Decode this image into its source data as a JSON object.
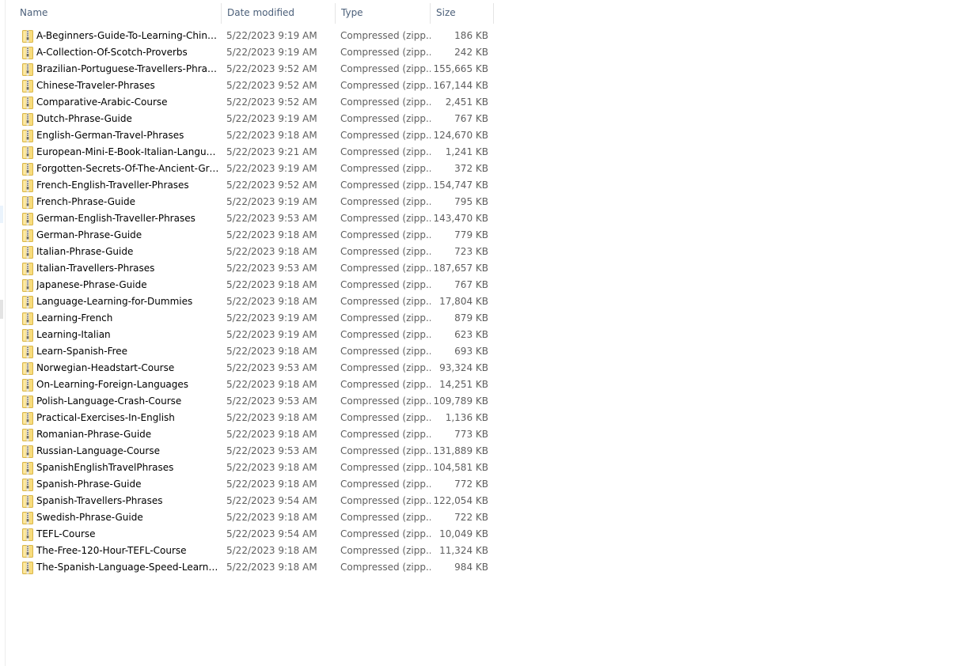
{
  "columns": {
    "name": "Name",
    "date": "Date modified",
    "type": "Type",
    "size": "Size",
    "sort_indicator": "^"
  },
  "icons": {
    "file": "zip-folder-icon",
    "sort": "sort-ascending-icon"
  },
  "colors": {
    "header_text": "#4c607a",
    "zip_folder": "#f3d36a",
    "zipper": "#8a8a8a"
  },
  "files": [
    {
      "name": "A-Beginners-Guide-To-Learning-Chinese",
      "date": "5/22/2023 9:19 AM",
      "type": "Compressed (zipp...",
      "size": "186 KB"
    },
    {
      "name": "A-Collection-Of-Scotch-Proverbs",
      "date": "5/22/2023 9:19 AM",
      "type": "Compressed (zipp...",
      "size": "242 KB"
    },
    {
      "name": "Brazilian-Portuguese-Travellers-Phrases",
      "date": "5/22/2023 9:52 AM",
      "type": "Compressed (zipp...",
      "size": "155,665 KB"
    },
    {
      "name": "Chinese-Traveler-Phrases",
      "date": "5/22/2023 9:52 AM",
      "type": "Compressed (zipp...",
      "size": "167,144 KB"
    },
    {
      "name": "Comparative-Arabic-Course",
      "date": "5/22/2023 9:52 AM",
      "type": "Compressed (zipp...",
      "size": "2,451 KB"
    },
    {
      "name": "Dutch-Phrase-Guide",
      "date": "5/22/2023 9:19 AM",
      "type": "Compressed (zipp...",
      "size": "767 KB"
    },
    {
      "name": "English-German-Travel-Phrases",
      "date": "5/22/2023 9:18 AM",
      "type": "Compressed (zipp...",
      "size": "124,670 KB"
    },
    {
      "name": "European-Mini-E-Book-Italian-Language...",
      "date": "5/22/2023 9:21 AM",
      "type": "Compressed (zipp...",
      "size": "1,241 KB"
    },
    {
      "name": "Forgotten-Secrets-Of-The-Ancient-Greek",
      "date": "5/22/2023 9:19 AM",
      "type": "Compressed (zipp...",
      "size": "372 KB"
    },
    {
      "name": "French-English-Traveller-Phrases",
      "date": "5/22/2023 9:52 AM",
      "type": "Compressed (zipp...",
      "size": "154,747 KB"
    },
    {
      "name": "French-Phrase-Guide",
      "date": "5/22/2023 9:19 AM",
      "type": "Compressed (zipp...",
      "size": "795 KB"
    },
    {
      "name": "German-English-Traveller-Phrases",
      "date": "5/22/2023 9:53 AM",
      "type": "Compressed (zipp...",
      "size": "143,470 KB"
    },
    {
      "name": "German-Phrase-Guide",
      "date": "5/22/2023 9:18 AM",
      "type": "Compressed (zipp...",
      "size": "779 KB"
    },
    {
      "name": "Italian-Phrase-Guide",
      "date": "5/22/2023 9:18 AM",
      "type": "Compressed (zipp...",
      "size": "723 KB"
    },
    {
      "name": "Italian-Travellers-Phrases",
      "date": "5/22/2023 9:53 AM",
      "type": "Compressed (zipp...",
      "size": "187,657 KB"
    },
    {
      "name": "Japanese-Phrase-Guide",
      "date": "5/22/2023 9:18 AM",
      "type": "Compressed (zipp...",
      "size": "767 KB"
    },
    {
      "name": "Language-Learning-for-Dummies",
      "date": "5/22/2023 9:18 AM",
      "type": "Compressed (zipp...",
      "size": "17,804 KB"
    },
    {
      "name": "Learning-French",
      "date": "5/22/2023 9:19 AM",
      "type": "Compressed (zipp...",
      "size": "879 KB"
    },
    {
      "name": "Learning-Italian",
      "date": "5/22/2023 9:19 AM",
      "type": "Compressed (zipp...",
      "size": "623 KB"
    },
    {
      "name": "Learn-Spanish-Free",
      "date": "5/22/2023 9:18 AM",
      "type": "Compressed (zipp...",
      "size": "693 KB"
    },
    {
      "name": "Norwegian-Headstart-Course",
      "date": "5/22/2023 9:53 AM",
      "type": "Compressed (zipp...",
      "size": "93,324 KB"
    },
    {
      "name": "On-Learning-Foreign-Languages",
      "date": "5/22/2023 9:18 AM",
      "type": "Compressed (zipp...",
      "size": "14,251 KB"
    },
    {
      "name": "Polish-Language-Crash-Course",
      "date": "5/22/2023 9:53 AM",
      "type": "Compressed (zipp...",
      "size": "109,789 KB"
    },
    {
      "name": "Practical-Exercises-In-English",
      "date": "5/22/2023 9:18 AM",
      "type": "Compressed (zipp...",
      "size": "1,136 KB"
    },
    {
      "name": "Romanian-Phrase-Guide",
      "date": "5/22/2023 9:18 AM",
      "type": "Compressed (zipp...",
      "size": "773 KB"
    },
    {
      "name": "Russian-Language-Course",
      "date": "5/22/2023 9:53 AM",
      "type": "Compressed (zipp...",
      "size": "131,889 KB"
    },
    {
      "name": "SpanishEnglishTravelPhrases",
      "date": "5/22/2023 9:18 AM",
      "type": "Compressed (zipp...",
      "size": "104,581 KB"
    },
    {
      "name": "Spanish-Phrase-Guide",
      "date": "5/22/2023 9:18 AM",
      "type": "Compressed (zipp...",
      "size": "772 KB"
    },
    {
      "name": "Spanish-Travellers-Phrases",
      "date": "5/22/2023 9:54 AM",
      "type": "Compressed (zipp...",
      "size": "122,054 KB"
    },
    {
      "name": "Swedish-Phrase-Guide",
      "date": "5/22/2023 9:18 AM",
      "type": "Compressed (zipp...",
      "size": "722 KB"
    },
    {
      "name": "TEFL-Course",
      "date": "5/22/2023 9:54 AM",
      "type": "Compressed (zipp...",
      "size": "10,049 KB"
    },
    {
      "name": "The-Free-120-Hour-TEFL-Course",
      "date": "5/22/2023 9:18 AM",
      "type": "Compressed (zipp...",
      "size": "11,324 KB"
    },
    {
      "name": "The-Spanish-Language-Speed-Learning-...",
      "date": "5/22/2023 9:18 AM",
      "type": "Compressed (zipp...",
      "size": "984 KB"
    }
  ]
}
